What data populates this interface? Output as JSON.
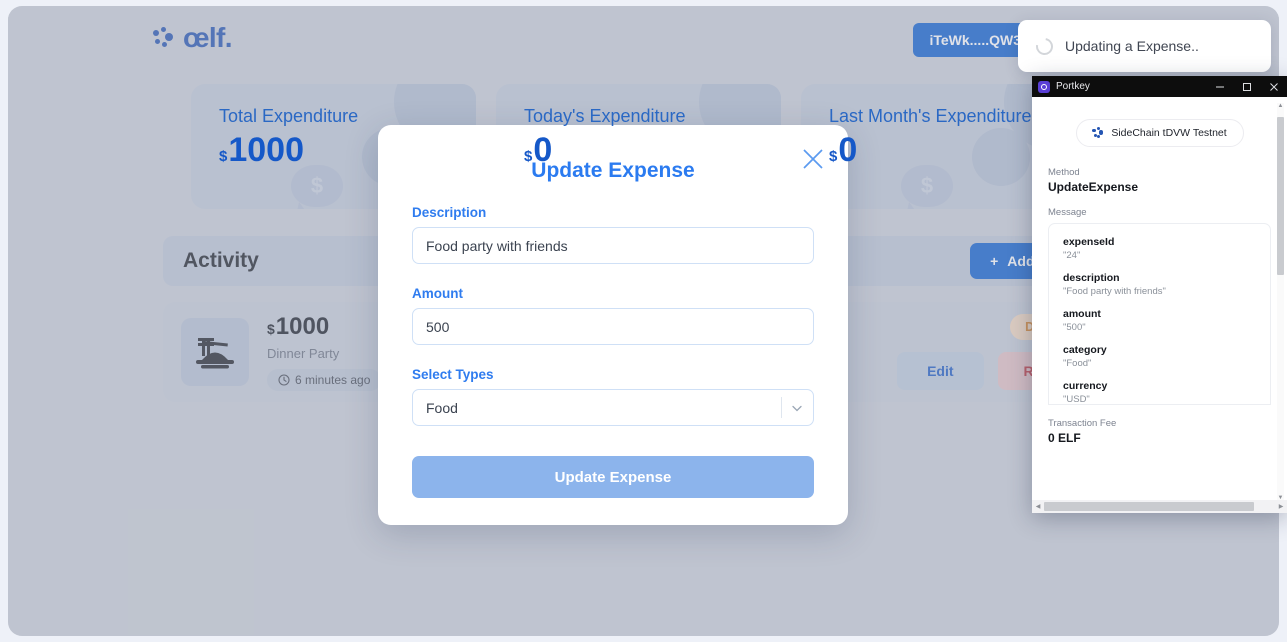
{
  "header": {
    "brand": "œlf.",
    "brand_icon": "aelf-logo-icon",
    "wallet_button": "iTeWk.....QW3"
  },
  "toast": {
    "message": "Updating a Expense..",
    "icon": "spinner-icon"
  },
  "stats": [
    {
      "title": "Total Expenditure",
      "currency": "$",
      "value": "1000"
    },
    {
      "title": "Today's Expenditure",
      "currency": "$",
      "value": "0"
    },
    {
      "title": "Last Month's Expenditure",
      "currency": "$",
      "value": "0"
    }
  ],
  "activity": {
    "heading": "Activity",
    "add_button": "Add Expense",
    "add_button_icon": "plus-icon",
    "items": [
      {
        "icon": "dinner-plate-icon",
        "currency": "$",
        "amount": "1000",
        "description": "Dinner Party",
        "time": "6 minutes ago",
        "time_icon": "clock-icon",
        "category_badge": "Dining Out",
        "edit_label": "Edit",
        "remove_label": "Remove"
      }
    ]
  },
  "modal": {
    "title": "Update Expense",
    "close_icon": "close-x-icon",
    "fields": {
      "description_label": "Description",
      "description_value": "Food party with friends",
      "amount_label": "Amount",
      "amount_value": "500",
      "type_label": "Select Types",
      "type_value": "Food",
      "type_chevron_icon": "chevron-down-icon"
    },
    "submit_label": "Update Expense"
  },
  "portkey": {
    "window_title": "Portkey",
    "window_icon": "portkey-logo-icon",
    "minimize_icon": "minimize-icon",
    "maximize_icon": "maximize-icon",
    "close_icon": "close-icon",
    "network_chip": "SideChain tDVW Testnet",
    "network_chip_icon": "aelf-mark-icon",
    "method_label": "Method",
    "method_value": "UpdateExpense",
    "message_label": "Message",
    "message_fields": [
      {
        "key": "expenseId",
        "value": "\"24\""
      },
      {
        "key": "description",
        "value": "\"Food party with friends\""
      },
      {
        "key": "amount",
        "value": "\"500\""
      },
      {
        "key": "category",
        "value": "\"Food\""
      },
      {
        "key": "currency",
        "value": "\"USD\""
      }
    ],
    "fee_label": "Transaction Fee",
    "fee_value": "0 ELF"
  },
  "colors": {
    "brand_blue": "#2455b3",
    "accent_blue": "#1061d1",
    "link_blue": "#2b7bf0",
    "page_bg": "#ccd1d9",
    "card_bg": "#c3cbd9",
    "badge_orange": "#d98328",
    "remove_red": "#c0343d"
  }
}
